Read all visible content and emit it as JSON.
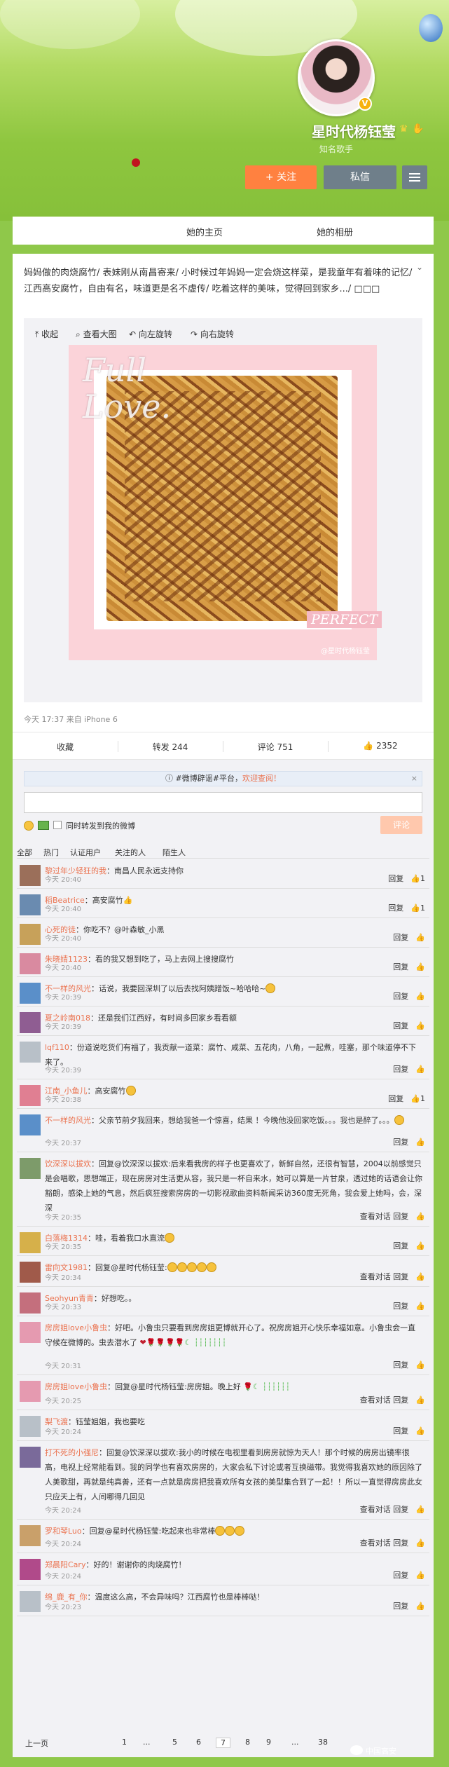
{
  "profile": {
    "name": "星时代杨钰莹",
    "desc": "知名歌手",
    "follow_label": "+ 关注",
    "message_label": "私信"
  },
  "tabs": [
    "她的主页",
    "她的相册"
  ],
  "post": {
    "text": "妈妈做的肉烧腐竹/ 表妹刚从南昌寄来/ 小时候过年妈妈一定会烧这样菜，是我童年有着味的记忆/ 江西高安腐竹，自由有名，味道更是名不虚传/ 吃着这样的美味，觉得回到家乡.../ □□□",
    "toolbar": [
      "收起",
      "查看大图",
      "向左旋转",
      "向右旋转"
    ],
    "photo_title_1": "Full",
    "photo_title_2": "Love.",
    "photo_tag": "PERFECT",
    "photo_watermark": "@星时代杨钰莹",
    "time": "今天 17:37 来自 iPhone 6",
    "actions": {
      "fav": "收藏",
      "repost": "转发 244",
      "comment": "评论 751",
      "like": "2352"
    }
  },
  "comment_box": {
    "notice_pre": "#微博辟谣#平台，",
    "notice_em": "欢迎查阅！",
    "repost_label": "同时转发到我的微博",
    "submit_label": "评论"
  },
  "filters": [
    "全部",
    "热门",
    "认证用户",
    "关注的人",
    "陌生人"
  ],
  "comments": [
    {
      "nick": "黎过年少轻狂的我",
      "text": "：南昌人民永远支持你",
      "time": "今天 20:40",
      "ops": "回复",
      "like": "1"
    },
    {
      "nick": "稻Beatrice",
      "text": "：高安腐竹",
      "time": "今天 20:40",
      "ops": "回复",
      "like": "1"
    },
    {
      "nick": "心死的徒",
      "text": "：你吃不？@叶森敏_小黑",
      "time": "今天 20:40",
      "ops": "回复",
      "like": ""
    },
    {
      "nick": "朱晓婧1123",
      "text": "：看的我又想到吃了，马上去网上搜搜腐竹",
      "time": "今天 20:40",
      "ops": "回复",
      "like": ""
    },
    {
      "nick": "不一样的风光",
      "text": "：话说，我要回深圳了以后去找阿姨蹭饭~哈哈哈~",
      "time": "今天 20:39",
      "ops": "回复",
      "like": ""
    },
    {
      "nick": "夏之岭南018",
      "text": "：还是我们江西好，有时间多回家乡看看额",
      "time": "今天 20:39",
      "ops": "回复",
      "like": ""
    },
    {
      "nick": "lqf110",
      "text": "：份道说吃货们有福了，我贡献一道菜：腐竹、咸菜、五花肉，八角，一起煮，哇塞，那个味道停不下来了。",
      "time": "今天 20:39",
      "ops": "回复",
      "like": ""
    },
    {
      "nick": "江南_小鱼儿",
      "text": "：高安腐竹",
      "time": "今天 20:38",
      "ops": "回复",
      "like": "1"
    },
    {
      "nick": "不一样的风光",
      "text": "：父亲节前夕我回来，想给我爸一个惊喜，结果 ！今晚他没回家吃饭。。。我也是醉了。。。",
      "time": "今天 20:37",
      "ops": "回复",
      "like": ""
    },
    {
      "nick": "饮深深以拔欢",
      "text": "：回复@饮深深以拔欢:后来看我房的样子也更喜欢了，新鲜自然，还很有智慧，2004以前感觉只是会唱歌，思想端正，现在房房对生活更从容，我只是一杯自来水，她可以算是一片甘泉，透过她的话语会让你豁朗，感染上她的气息，然后疯狂搜索房房的一切影视歌曲资料新闻采访360度无死角，我会爱上她吗，会，深深",
      "time": "今天 20:35",
      "ops": "查看对话 回复",
      "like": ""
    },
    {
      "nick": "白落梅1314",
      "text": "：哇，看着我口水直流",
      "time": "今天 20:35",
      "ops": "回复",
      "like": ""
    },
    {
      "nick": "雷向文1981",
      "text": "：回复@星时代杨钰莹:",
      "time": "今天 20:34",
      "ops": "查看对话 回复",
      "like": ""
    },
    {
      "nick": "Seohyun青青",
      "text": "：好想吃。。",
      "time": "今天 20:33",
      "ops": "回复",
      "like": ""
    },
    {
      "nick": "房房姐love小鲁虫",
      "text": "：好吧。小鲁虫只要看到房房姐更博就开心了。祝房房姐开心快乐幸福如意。小鲁虫会一直守候在微博的。虫去潜水了",
      "time": "今天 20:31",
      "ops": "回复",
      "like": ""
    },
    {
      "nick": "房房姐love小鲁虫",
      "text": "：回复@星时代杨钰莹:房房姐。晚上好",
      "time": "今天 20:25",
      "ops": "查看对话 回复",
      "like": ""
    },
    {
      "nick": "梨飞渡",
      "text": "：钰莹姐姐，我也要吃",
      "time": "今天 20:24",
      "ops": "回复",
      "like": ""
    },
    {
      "nick": "打不死的小强尼",
      "text": "：回复@饮深深以拔欢:我小的时候在电视里看到房房就惊为天人！那个时候的房房出镜率很高，电视上经常能看到。我的同学也有喜欢房房的，大家会私下讨论或者互换磁带。我觉得我喜欢她的原因除了人美歌甜，再就是纯真善，还有一点就是房房把我喜欢所有女孩的美型集合到了一起！！所以一直觉得房房此女只应天上有，人间哪得几回见",
      "time": "今天 20:24",
      "ops": "查看对话 回复",
      "like": ""
    },
    {
      "nick": "罗和琴Luo",
      "text": "：回复@星时代杨钰莹:吃起来也非常棒",
      "time": "今天 20:24",
      "ops": "查看对话 回复",
      "like": ""
    },
    {
      "nick": "郑晨阳Cary",
      "text": "：好的！谢谢你的肉烧腐竹！",
      "time": "今天 20:24",
      "ops": "回复",
      "like": ""
    },
    {
      "nick": "绵_鹿_有_你",
      "text": "：温度这么高，不会异味吗？江西腐竹也是棒棒哒！",
      "time": "今天 20:23",
      "ops": "回复",
      "like": ""
    }
  ],
  "pager": {
    "prev": "上一页",
    "pages": [
      "1",
      "...",
      "5",
      "6",
      "7",
      "8",
      "9",
      "...",
      "38"
    ],
    "current": "7"
  },
  "watermark": "中国高安"
}
